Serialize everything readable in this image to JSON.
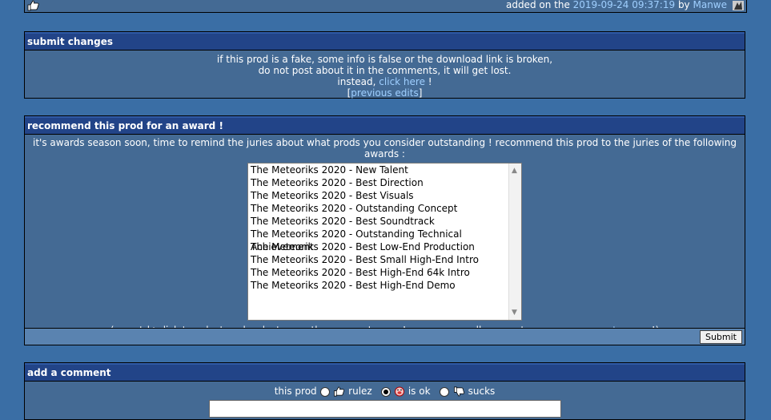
{
  "top_bar": {
    "added_prefix": "added on the",
    "added_date": "2019-09-24 09:37:19",
    "by": "by",
    "user": "Manwe"
  },
  "submit_changes": {
    "title": "submit changes",
    "line1": "if this prod is a fake, some info is false or the download link is broken,",
    "line2": "do not post about it in the comments, it will get lost.",
    "line3_prefix": "instead,",
    "click_here": "click here",
    "line3_suffix": "!",
    "bracket_open": "[",
    "previous_edits": "previous edits",
    "bracket_close": "]"
  },
  "award": {
    "title": "recommend this prod for an award !",
    "intro": "it's awards season soon, time to remind the juries about what prods you consider outstanding ! recommend this prod to the juries of the following awards :",
    "options": [
      "The Meteoriks 2020 - New Talent",
      "The Meteoriks 2020 - Best Direction",
      "The Meteoriks 2020 - Best Visuals",
      "The Meteoriks 2020 - Outstanding Concept",
      "The Meteoriks 2020 - Best Soundtrack",
      "The Meteoriks 2020 - Outstanding Technical Achievement",
      "The Meteoriks 2020 - Best Low-End Production",
      "The Meteoriks 2020 - Best Small High-End Intro",
      "The Meteoriks 2020 - Best High-End 64k Intro",
      "The Meteoriks 2020 - Best High-End Demo"
    ],
    "hint_prefix": "(use ctrl+click to select or deselect more than one category ! you can see all your votes on your",
    "accounts_page": "accounts page",
    "hint_suffix": "!)",
    "submit_label": "Submit"
  },
  "comment": {
    "title": "add a comment",
    "this_prod": "this prod",
    "rulez": "rulez",
    "is_ok": "is ok",
    "sucks": "sucks",
    "selected": "is ok"
  }
}
